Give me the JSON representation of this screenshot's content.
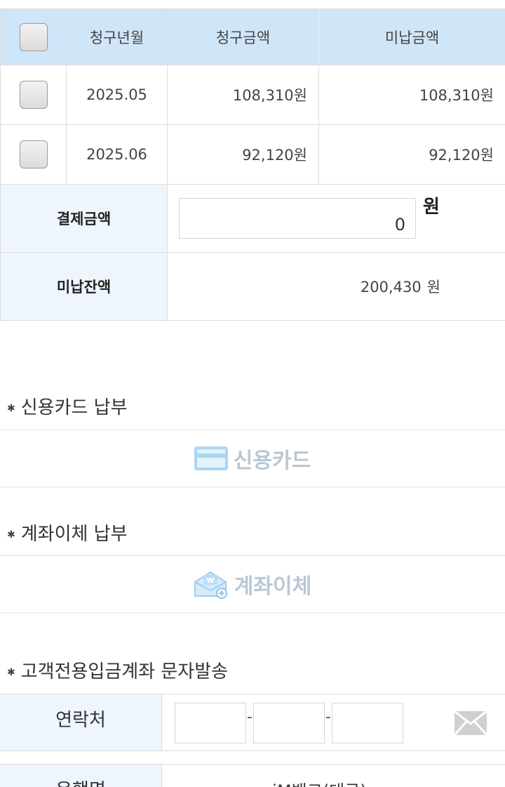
{
  "table": {
    "headers": {
      "bill_month": "청구년월",
      "bill_amount": "청구금액",
      "unpaid_amount": "미납금액"
    },
    "rows": [
      {
        "month": "2025.05",
        "bill": "108,310원",
        "unpaid": "108,310원"
      },
      {
        "month": "2025.06",
        "bill": "92,120원",
        "unpaid": "92,120원"
      }
    ],
    "payment_label": "결제금액",
    "payment_value": "0",
    "payment_unit": "원",
    "balance_label": "미납잔액",
    "balance_value": "200,430",
    "balance_unit": "원"
  },
  "card_section": {
    "title": "신용카드 납부",
    "button_label": "신용카드",
    "icon": "credit-card-icon"
  },
  "transfer_section": {
    "title": "계좌이체 납부",
    "button_label": "계좌이체",
    "icon": "bank-transfer-envelope-icon"
  },
  "sms_section": {
    "title": "고객전용입금계좌 문자발송",
    "contact_label": "연락처",
    "separator": "-",
    "send_icon": "envelope-icon",
    "bank_label": "은행명",
    "bank_value": "iM뱅크(대구)"
  }
}
